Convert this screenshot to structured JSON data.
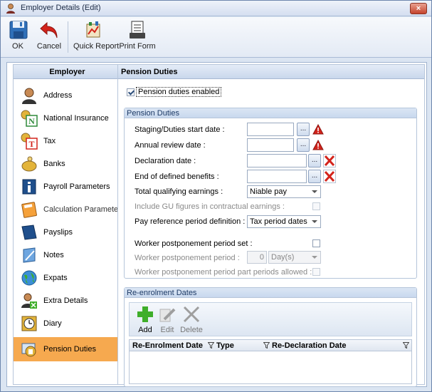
{
  "window": {
    "title": "Employer Details (Edit)",
    "close_label": "×"
  },
  "toolbar": {
    "ok_label": "OK",
    "cancel_label": "Cancel",
    "quick_report_label": "Quick Report",
    "print_form_label": "Print Form"
  },
  "left_panel": {
    "header": "Employer",
    "items": [
      {
        "label": "Address",
        "icon": "person-icon"
      },
      {
        "label": "National Insurance",
        "icon": "national-insurance-icon"
      },
      {
        "label": "Tax",
        "icon": "tax-icon"
      },
      {
        "label": "Banks",
        "icon": "piggy-bank-icon"
      },
      {
        "label": "Payroll Parameters",
        "icon": "info-book-icon"
      },
      {
        "label": "Calculation Paramete...",
        "icon": "calculator-icon"
      },
      {
        "label": "Payslips",
        "icon": "payslip-book-icon"
      },
      {
        "label": "Notes",
        "icon": "notepad-icon"
      },
      {
        "label": "Expats",
        "icon": "globe-icon"
      },
      {
        "label": "Extra Details",
        "icon": "person-extra-icon"
      },
      {
        "label": "Diary",
        "icon": "clock-icon"
      },
      {
        "label": "Pension Duties",
        "icon": "pension-icon",
        "selected": true
      }
    ]
  },
  "right_panel": {
    "header": "Pension Duties",
    "pension_enabled_label": "Pension duties enabled",
    "pension_enabled": true,
    "duties_group": {
      "title": "Pension Duties",
      "staging_label": "Staging/Duties start date :",
      "staging_value": "",
      "annual_review_label": "Annual review date :",
      "annual_review_value": "",
      "declaration_label": "Declaration date :",
      "declaration_value": "",
      "end_defined_label": "End of defined benefits :",
      "end_defined_value": "",
      "total_qualifying_label": "Total qualifying earnings :",
      "total_qualifying_value": "Niable pay",
      "include_gu_label": "Include GU figures in contractual earnings :",
      "include_gu_checked": false,
      "pay_ref_label": "Pay reference period definition :",
      "pay_ref_value": "Tax period dates",
      "worker_set_label": "Worker postponement period set :",
      "worker_set_checked": false,
      "worker_period_label": "Worker postponement period :",
      "worker_period_number": "0",
      "worker_period_unit": "Day(s)",
      "worker_part_label": "Worker postponement period part periods allowed :",
      "worker_part_checked": false,
      "dots_label": "..."
    },
    "reenrol_group": {
      "title": "Re-enrolment Dates",
      "add_label": "Add",
      "edit_label": "Edit",
      "delete_label": "Delete",
      "columns": [
        "Re-Enrolment Date",
        "Type",
        "Re-Declaration Date"
      ],
      "rows": []
    }
  },
  "colors": {
    "selected_nav": "#f6a94f",
    "header_bg": "#c9d7ec",
    "warning_red": "#d3231b",
    "add_green": "#3fae2a"
  }
}
